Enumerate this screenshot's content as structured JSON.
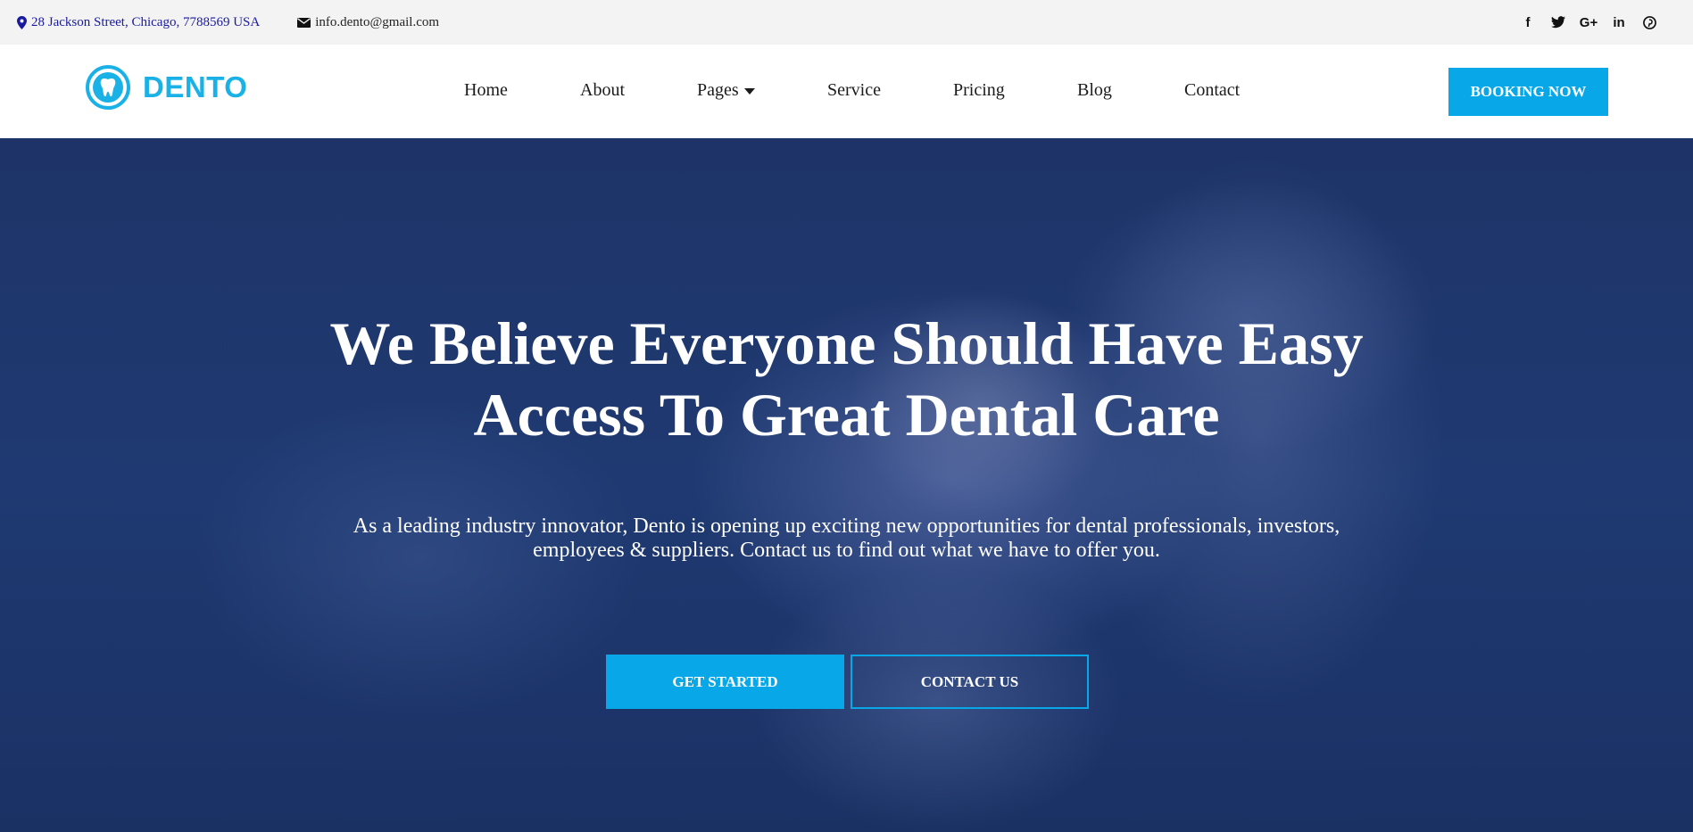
{
  "topbar": {
    "address": "28 Jackson Street, Chicago, 7788569 USA",
    "email": "info.dento@gmail.com",
    "social": [
      {
        "icon": "facebook-icon",
        "glyph": "f"
      },
      {
        "icon": "twitter-icon",
        "glyph": "t"
      },
      {
        "icon": "google-plus-icon",
        "glyph": "G+"
      },
      {
        "icon": "linkedin-icon",
        "glyph": "in"
      },
      {
        "icon": "pinterest-icon",
        "glyph": "p"
      }
    ]
  },
  "header": {
    "logo_text": "DENTO",
    "nav": [
      "Home",
      "About",
      "Pages",
      "Service",
      "Pricing",
      "Blog",
      "Contact"
    ],
    "booking_label": "BOOKING NOW"
  },
  "hero": {
    "title_line1": "We Believe Everyone Should Have Easy",
    "title_line2": "Access To Great Dental Care",
    "subtitle": "As a leading industry innovator, Dento is opening up exciting new opportunities for dental professionals, investors, employees & suppliers. Contact us to find out what we have to offer you.",
    "primary_button": "GET STARTED",
    "secondary_button": "CONTACT US"
  },
  "colors": {
    "accent": "#08a7e8",
    "logo": "#1ab1e6",
    "hero_overlay": "#1f3a72",
    "address_text": "#1a1a9e"
  }
}
